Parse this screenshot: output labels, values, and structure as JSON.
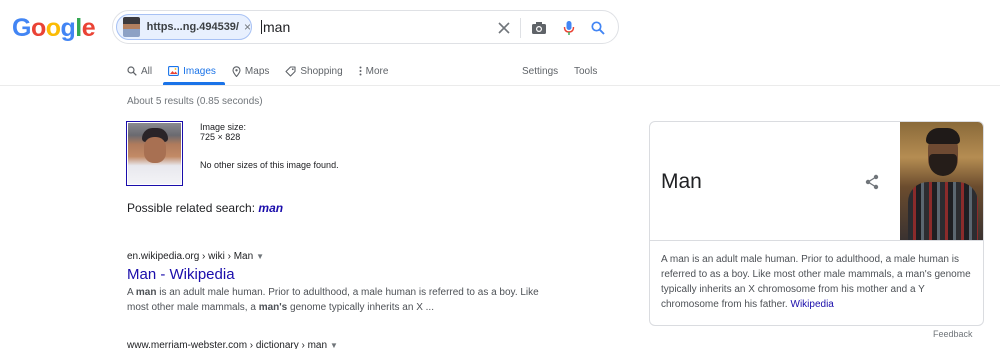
{
  "logo": {
    "letters": [
      "G",
      "o",
      "o",
      "g",
      "l",
      "e"
    ],
    "colors": [
      "#4285f4",
      "#ea4335",
      "#fbbc05",
      "#4285f4",
      "#34a853",
      "#ea4335"
    ]
  },
  "search": {
    "chip_label": "https...ng.494539/",
    "chip_close": "×",
    "query": "man",
    "icons": [
      "clear-icon",
      "camera-icon",
      "mic-icon",
      "search-icon"
    ]
  },
  "tabs": [
    {
      "label": "All",
      "icon": "search-icon",
      "active": false
    },
    {
      "label": "Images",
      "icon": "image-icon",
      "active": true
    },
    {
      "label": "Maps",
      "icon": "map-pin-icon",
      "active": false
    },
    {
      "label": "Shopping",
      "icon": "tag-icon",
      "active": false
    },
    {
      "label": "More",
      "icon": "more-vert-icon",
      "active": false
    }
  ],
  "settings_label": "Settings",
  "tools_label": "Tools",
  "stats": "About 5 results (0.85 seconds)",
  "image_info": {
    "size_label": "Image size:",
    "size_value": "725 × 828",
    "no_other": "No other sizes of this image found."
  },
  "related": {
    "prefix": "Possible related search: ",
    "term": "man"
  },
  "results": [
    {
      "crumb": "en.wikipedia.org › wiki › Man",
      "title": "Man - Wikipedia",
      "snippet_parts": [
        "A ",
        "man",
        " is an adult male human. Prior to adulthood, a male human is referred to as a boy. Like most other male mammals, a ",
        "man's",
        " genome typically inherits an X ..."
      ]
    },
    {
      "crumb": "www.merriam-webster.com › dictionary › man"
    }
  ],
  "knowledge_panel": {
    "title": "Man",
    "description": "A man is an adult male human. Prior to adulthood, a male human is referred to as a boy. Like most other male mammals, a man's genome typically inherits an X chromosome from his mother and a Y chromosome from his father.",
    "source_link": "Wikipedia"
  },
  "feedback_label": "Feedback"
}
